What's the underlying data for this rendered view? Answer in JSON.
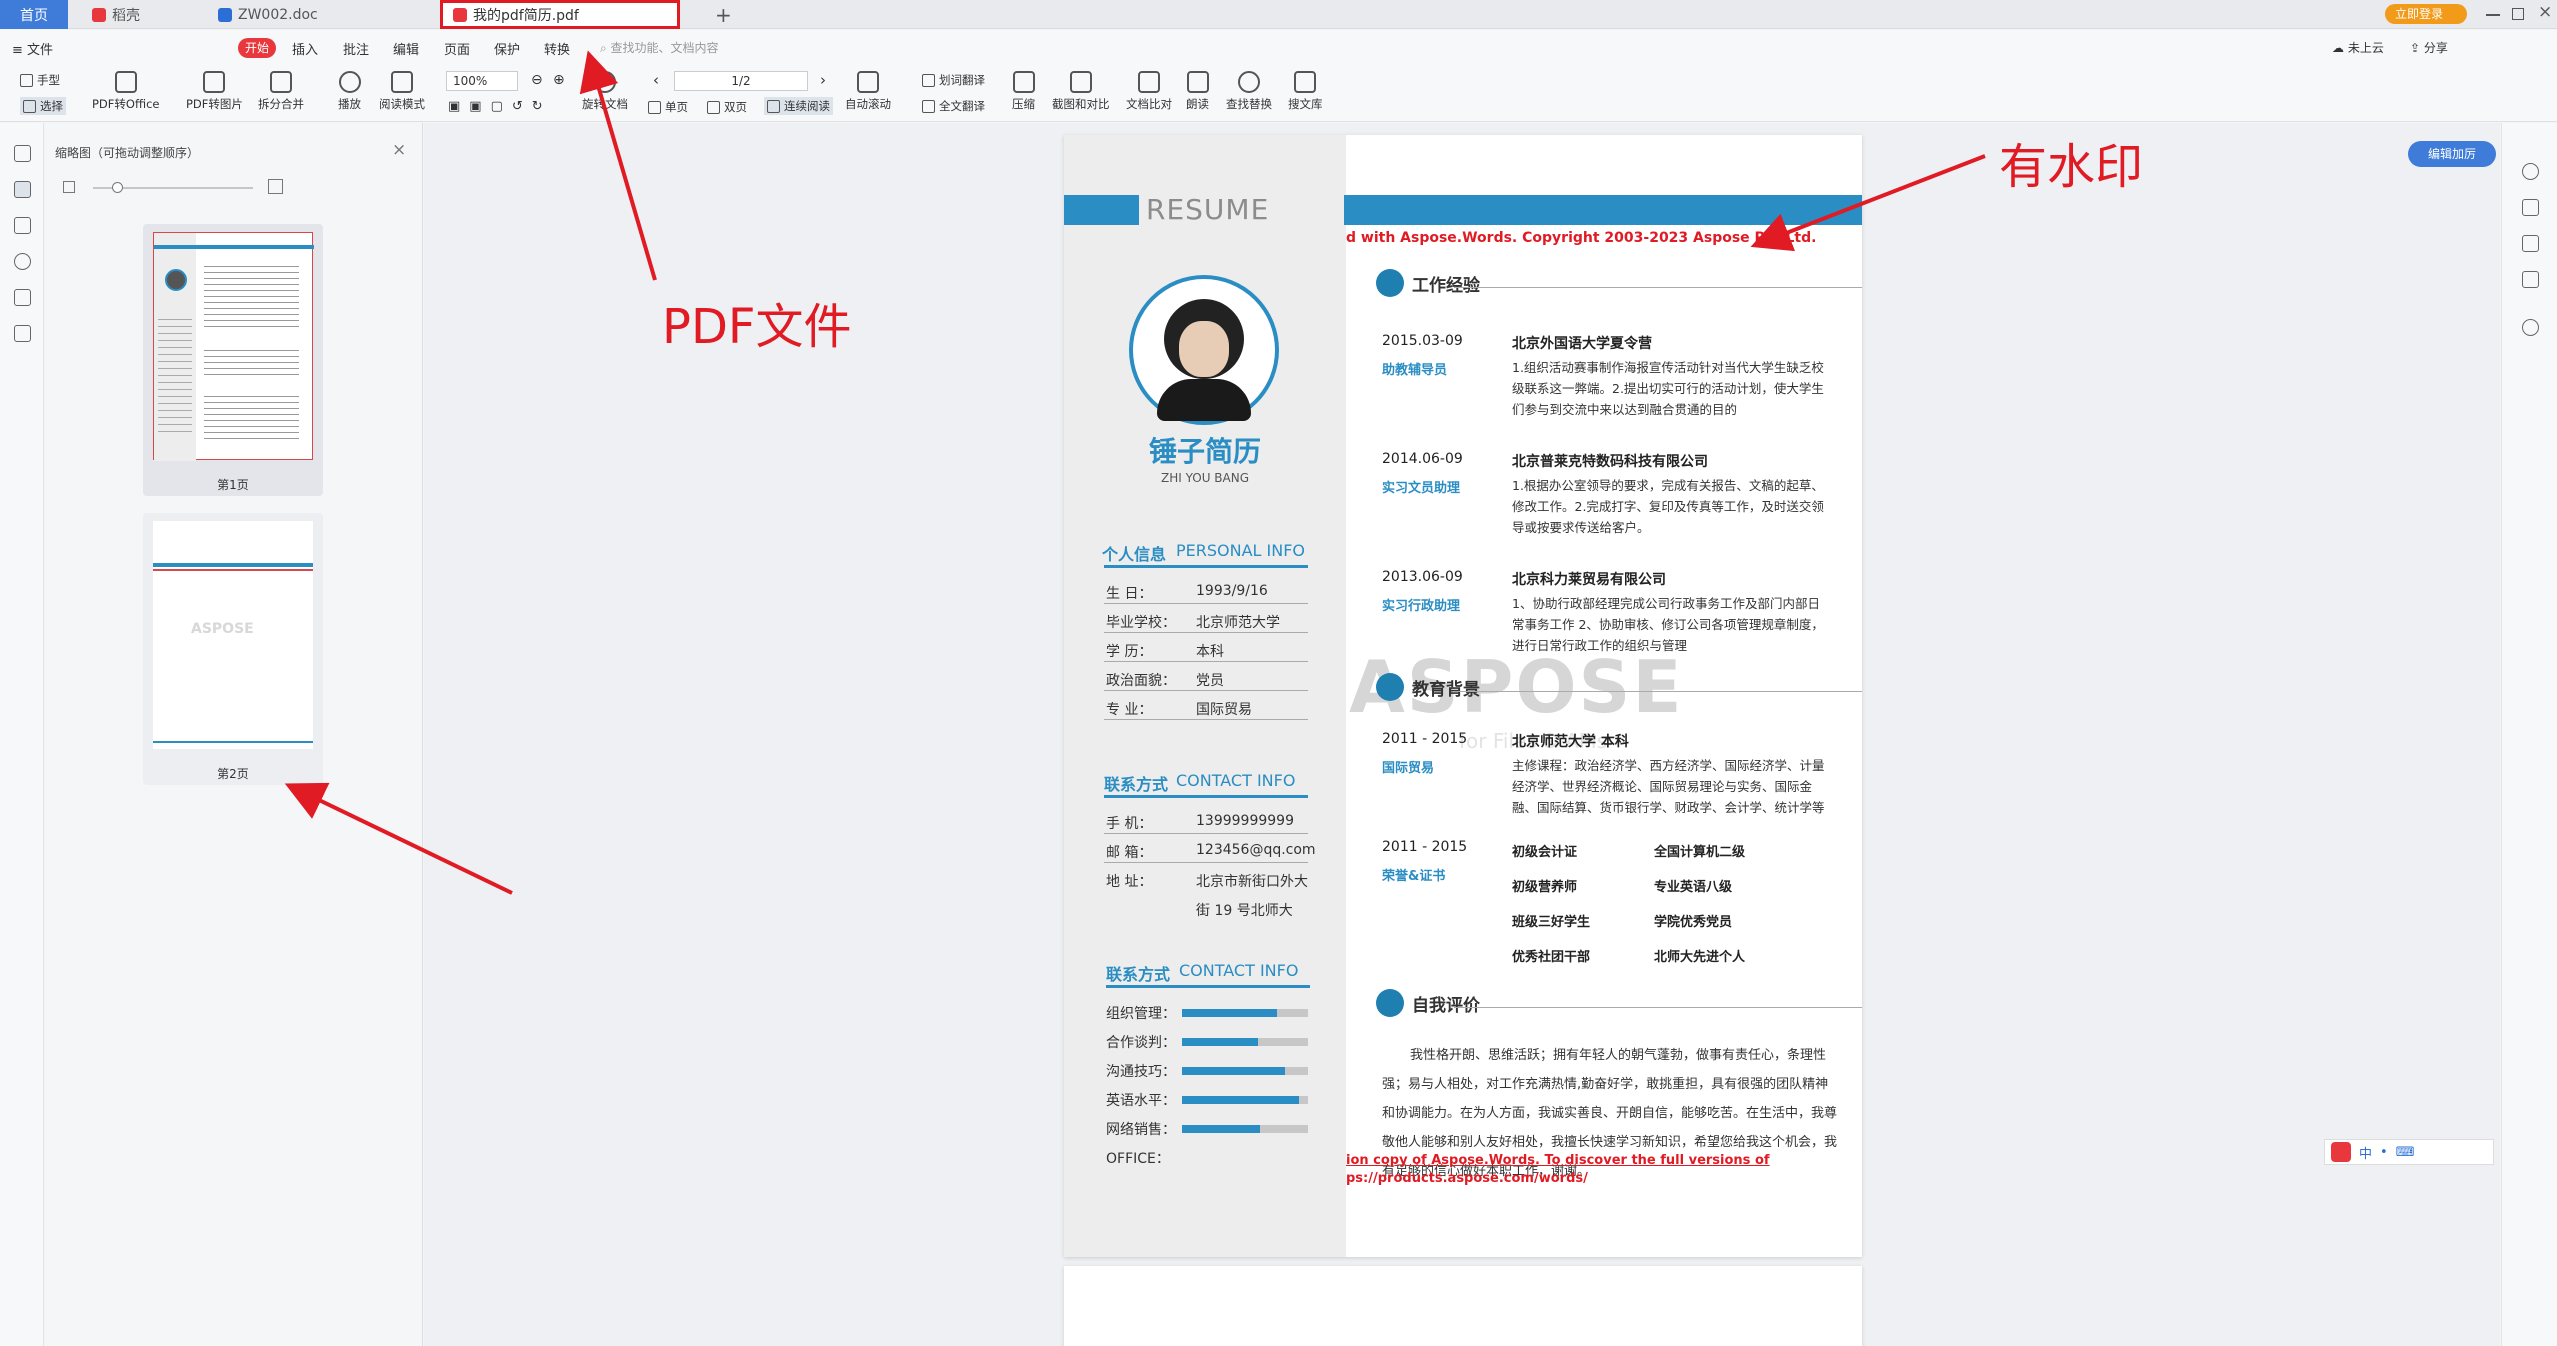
{
  "tabs": [
    {
      "label": "首页"
    },
    {
      "label": "稻壳"
    },
    {
      "label": "ZW002.doc"
    },
    {
      "label": "我的pdf简历.pdf"
    }
  ],
  "topright": {
    "login": "立即登录"
  },
  "menu": {
    "file": "文件",
    "items": [
      "开始",
      "插入",
      "批注",
      "编辑",
      "页面",
      "保护",
      "转换"
    ],
    "search_placeholder": "查找功能、文档内容",
    "right": [
      "未上云",
      "分享"
    ]
  },
  "toolbar": {
    "hand": "手型",
    "select": "选择",
    "pdf_office": "PDF转Office",
    "pdf_img": "PDF转图片",
    "split": "拆分合并",
    "play": "播放",
    "read": "阅读模式",
    "zoom": "100%",
    "page": "1/2",
    "rotate": "旋转文档",
    "single": "单页",
    "double": "双页",
    "continuous": "连续阅读",
    "autoscroll": "自动滚动",
    "translate": "划词翻译",
    "fulltrans": "全文翻译",
    "compress": "压缩",
    "compare": "截图和对比",
    "textcompare": "文档比对",
    "readaloud": "朗读",
    "findreplace": "查找替换",
    "search": "搜文库"
  },
  "thumbpanel": {
    "title": "缩略图（可拖动调整顺序）",
    "page1": "第1页",
    "page2": "第2页",
    "page2_watermark": "ASPOSE"
  },
  "edit_btn": "编辑加厉",
  "resume": {
    "header": "RESUME",
    "watermark_top": "d with Aspose.Words. Copyright 2003-2023 Aspose Pty Ltd.",
    "watermark_big": "ASPOSE",
    "watermark_sub": "for Files & APIs",
    "watermark_bottom1": "ion copy of Aspose.Words. To discover the full versions of",
    "watermark_bottom2": "ps://products.aspose.com/words/",
    "name": "锤子简历",
    "name_en": "ZHI YOU BANG",
    "personal_title_cn": "个人信息",
    "personal_title_en": "PERSONAL INFO",
    "personal": [
      {
        "k": "生      日：",
        "v": "1993/9/16"
      },
      {
        "k": "毕业学校：",
        "v": "北京师范大学"
      },
      {
        "k": "学      历：",
        "v": "本科"
      },
      {
        "k": "政治面貌：",
        "v": "党员"
      },
      {
        "k": "专      业：",
        "v": "国际贸易"
      }
    ],
    "contact_title_cn": "联系方式",
    "contact_title_en": "CONTACT INFO",
    "contact": [
      {
        "k": "手      机：",
        "v": "13999999999"
      },
      {
        "k": "邮      箱：",
        "v": "123456@qq.com"
      },
      {
        "k": "地      址：",
        "v": "北京市新街口外大"
      },
      {
        "k": "",
        "v": "街 19 号北师大"
      }
    ],
    "skills_title_cn": "联系方式",
    "skills_title_en": "CONTACT INFO",
    "skills": [
      {
        "k": "组织管理：",
        "level": 0.75
      },
      {
        "k": "合作谈判：",
        "level": 0.6
      },
      {
        "k": "沟通技巧：",
        "level": 0.82
      },
      {
        "k": "英语水平：",
        "level": 0.93
      },
      {
        "k": "网络销售：",
        "level": 0.62
      },
      {
        "k": "OFFICE：",
        "level": null
      }
    ],
    "work_title": "工作经验",
    "jobs": [
      {
        "date": "2015.03-09",
        "company": "北京外国语大学夏令营",
        "role": "助教辅导员",
        "desc": "1.组织活动赛事制作海报宣传活动针对当代大学生缺乏校级联系这一弊端。2.提出切实可行的活动计划，使大学生们参与到交流中来以达到融合贯通的目的"
      },
      {
        "date": "2014.06-09",
        "company": "北京普莱克特数码科技有限公司",
        "role": "实习文员助理",
        "desc": "1.根据办公室领导的要求，完成有关报告、文稿的起草、修改工作。2.完成打字、复印及传真等工作，及时送交领导或按要求传送给客户。"
      },
      {
        "date": "2013.06-09",
        "company": "北京科力莱贸易有限公司",
        "role": "实习行政助理",
        "desc": "1、协助行政部经理完成公司行政事务工作及部门内部日常事务工作 2、协助审核、修订公司各项管理规章制度，进行日常行政工作的组织与管理"
      }
    ],
    "edu_title": "教育背景",
    "edu": {
      "date": "2011 - 2015",
      "school": "北京师范大学    本科",
      "major": "国际贸易",
      "desc": "主修课程：政治经济学、西方经济学、国际经济学、计量经济学、世界经济概论、国际贸易理论与实务、国际金融、国际结算、货币银行学、财政学、会计学、统计学等"
    },
    "cert": {
      "date": "2011 - 2015",
      "label": "荣誉&证书",
      "items": [
        "初级会计证",
        "全国计算机二级",
        "初级营养师",
        "专业英语八级",
        "班级三好学生",
        "学院优秀党员",
        "优秀社团干部",
        "北师大先进个人"
      ]
    },
    "self_title": "自我评价",
    "self": "我性格开朗、思维活跃；拥有年轻人的朝气蓬勃，做事有责任心，条理性强；易与人相处，对工作充满热情,勤奋好学，敢挑重担，具有很强的团队精神和协调能力。在为人方面，我诚实善良、开朗自信，能够吃苦。在生活中，我尊敬他人能够和别人友好相处，我擅长快速学习新知识，希望您给我这个机会，我有足够的信心做好本职工作，谢谢。"
  },
  "annotations": {
    "pdf": "PDF文件",
    "watermark": "有水印"
  },
  "ime": [
    "中",
    "•",
    "⌨"
  ]
}
